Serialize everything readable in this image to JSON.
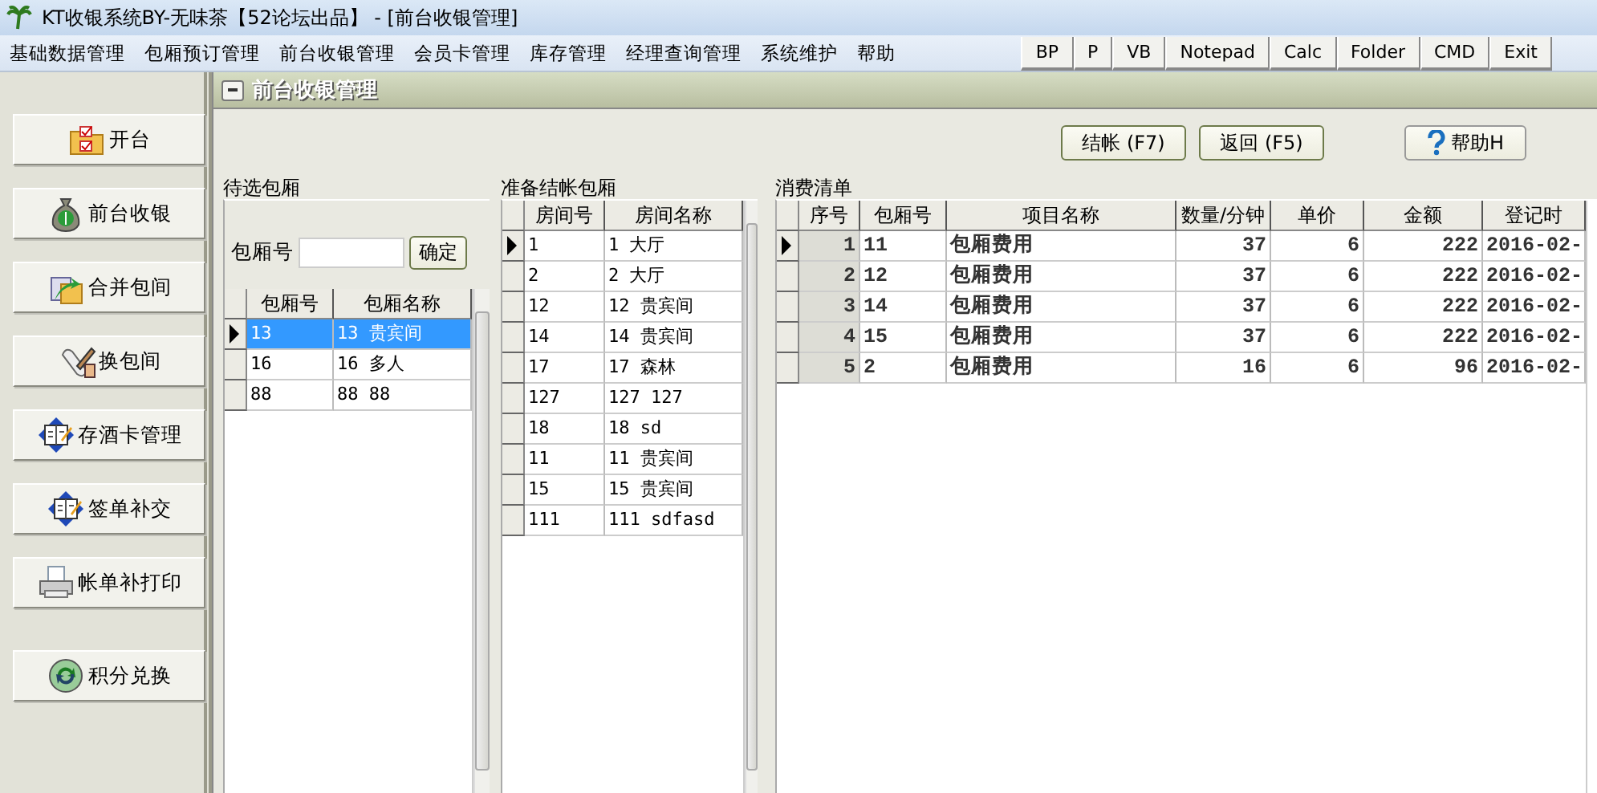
{
  "window": {
    "title": "KT收银系统BY-无味茶【52论坛出品】  - [前台收银管理]"
  },
  "menu": [
    "基础数据管理",
    "包厢预订管理",
    "前台收银管理",
    "会员卡管理",
    "库存管理",
    "经理查询管理",
    "系统维护",
    "帮助"
  ],
  "toolbar": [
    "BP",
    "P",
    "VB",
    "Notepad",
    "Calc",
    "Folder",
    "CMD",
    "Exit"
  ],
  "sidebar": [
    {
      "label": "开台",
      "kind": "folder"
    },
    {
      "label": "前台收银",
      "kind": "moneybag"
    },
    {
      "label": "合并包间",
      "kind": "merge"
    },
    {
      "label": "换包间",
      "kind": "scroll"
    },
    {
      "label": "存酒卡管理",
      "kind": "book"
    },
    {
      "label": "签单补交",
      "kind": "book"
    },
    {
      "label": "帐单补打印",
      "kind": "printer"
    },
    {
      "label": "积分兑换",
      "kind": "refresh"
    }
  ],
  "panel": {
    "title": "前台收银管理",
    "actions": [
      {
        "label": "结帐 (F7)",
        "kind": "plain"
      },
      {
        "label": "返回 (F5)",
        "kind": "plain"
      },
      {
        "label": "帮助H",
        "kind": "help"
      }
    ],
    "candidates": {
      "title": "待选包厢",
      "field_label": "包厢号",
      "confirm": "确定",
      "columns": [
        "包厢号",
        "包厢名称"
      ],
      "rows": [
        {
          "cells": [
            "13",
            "13 贵宾间"
          ],
          "selected": true
        },
        {
          "cells": [
            "16",
            "16 多人"
          ],
          "selected": false
        },
        {
          "cells": [
            "88",
            "88 88"
          ],
          "selected": false
        }
      ]
    },
    "checkout": {
      "title": "准备结帐包厢",
      "columns": [
        "房间号",
        "房间名称"
      ],
      "rows": [
        {
          "cells": [
            "1",
            "1 大厅"
          ],
          "current": true
        },
        {
          "cells": [
            "2",
            "2 大厅"
          ],
          "current": false
        },
        {
          "cells": [
            "12",
            "12 贵宾间"
          ],
          "current": false
        },
        {
          "cells": [
            "14",
            "14 贵宾间"
          ],
          "current": false
        },
        {
          "cells": [
            "17",
            "17 森林"
          ],
          "current": false
        },
        {
          "cells": [
            "127",
            "127 127"
          ],
          "current": false
        },
        {
          "cells": [
            "18",
            "18 sd"
          ],
          "current": false
        },
        {
          "cells": [
            "11",
            "11 贵宾间"
          ],
          "current": false
        },
        {
          "cells": [
            "15",
            "15 贵宾间"
          ],
          "current": false
        },
        {
          "cells": [
            "111",
            "111 sdfasd"
          ],
          "current": false
        }
      ]
    },
    "bill": {
      "title": "消费清单",
      "columns": [
        "序号",
        "包厢号",
        "项目名称",
        "数量/分钟",
        "单价",
        "金额",
        "登记时"
      ],
      "rows": [
        {
          "cells": [
            "1",
            "11",
            "包厢费用",
            "37",
            "6",
            "222",
            "2016-02-"
          ],
          "current": true
        },
        {
          "cells": [
            "2",
            "12",
            "包厢费用",
            "37",
            "6",
            "222",
            "2016-02-"
          ],
          "current": false
        },
        {
          "cells": [
            "3",
            "14",
            "包厢费用",
            "37",
            "6",
            "222",
            "2016-02-"
          ],
          "current": false
        },
        {
          "cells": [
            "4",
            "15",
            "包厢费用",
            "37",
            "6",
            "222",
            "2016-02-"
          ],
          "current": false
        },
        {
          "cells": [
            "5",
            "2",
            "包厢费用",
            "16",
            "6",
            "96",
            "2016-02-"
          ],
          "current": false
        }
      ]
    }
  }
}
